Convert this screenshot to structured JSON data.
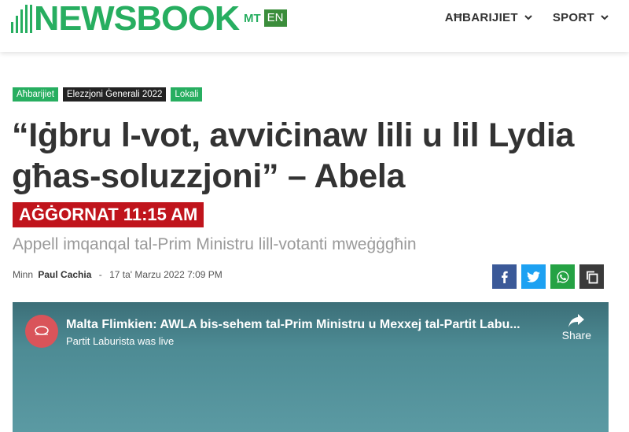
{
  "header": {
    "logo_text": "NEWSBOOK",
    "lang_mt": "MT",
    "lang_en": "EN",
    "nav": [
      {
        "label": "AĦBARIJIET"
      },
      {
        "label": "SPORT"
      }
    ]
  },
  "tags": [
    "Aħbarijiet",
    "Elezzjoni Ġenerali 2022",
    "Lokali"
  ],
  "article": {
    "title": "“Iġbru l-vot, avviċinaw lili u lil Lydia għas-soluzzjoni” – Abela",
    "updated_badge": "AĠĠORNAT 11:15 AM",
    "subtitle": "Appell imqanqal tal-Prim Ministru lill-votanti mweġġgħin",
    "byline_prefix": "Minn",
    "author": "Paul Cachia",
    "date_separator": "-",
    "date": "17 ta' Marzu 2022 7:09 PM"
  },
  "video": {
    "title": "Malta Flimkien: AWLA bis-sehem tal-Prim Ministru u Mexxej tal-Partit Labu...",
    "subtitle": "Partit Laburista was live",
    "share_label": "Share"
  },
  "colors": {
    "brand_green": "#27ae60",
    "updated_red": "#c0141c",
    "facebook": "#3b5998",
    "twitter": "#1da1f2",
    "whatsapp": "#25a244"
  },
  "icons": [
    "chevron-down-icon",
    "facebook-icon",
    "twitter-icon",
    "whatsapp-icon",
    "copy-icon",
    "share-arrow-icon"
  ]
}
